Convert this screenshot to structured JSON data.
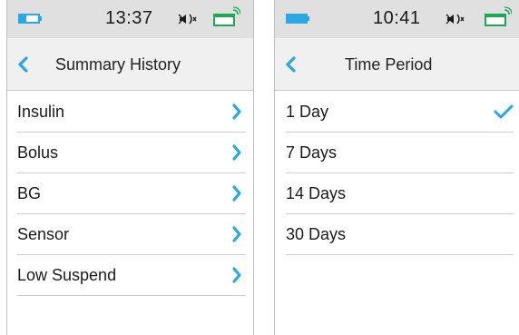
{
  "colors": {
    "accent": "#29a9e1",
    "status_bar_bg": "#e0e0e0",
    "header_bg": "#f0f0f0",
    "signal_green": "#1aaa55"
  },
  "left_screen": {
    "status": {
      "time": "13:37",
      "battery_level": 0.35,
      "icons": [
        "battery-icon",
        "mute-icon",
        "signal-icon"
      ]
    },
    "header": {
      "title": "Summary History",
      "back_icon": "chevron-left-icon"
    },
    "items": [
      {
        "label": "Insulin"
      },
      {
        "label": "Bolus"
      },
      {
        "label": "BG"
      },
      {
        "label": "Sensor"
      },
      {
        "label": "Low Suspend"
      }
    ]
  },
  "right_screen": {
    "status": {
      "time": "10:41",
      "battery_level": 1.0,
      "icons": [
        "battery-icon",
        "mute-icon",
        "signal-icon"
      ]
    },
    "header": {
      "title": "Time Period",
      "back_icon": "chevron-left-icon"
    },
    "items": [
      {
        "label": "1 Day",
        "selected": true
      },
      {
        "label": "7 Days",
        "selected": false
      },
      {
        "label": "14 Days",
        "selected": false
      },
      {
        "label": "30 Days",
        "selected": false
      }
    ]
  }
}
